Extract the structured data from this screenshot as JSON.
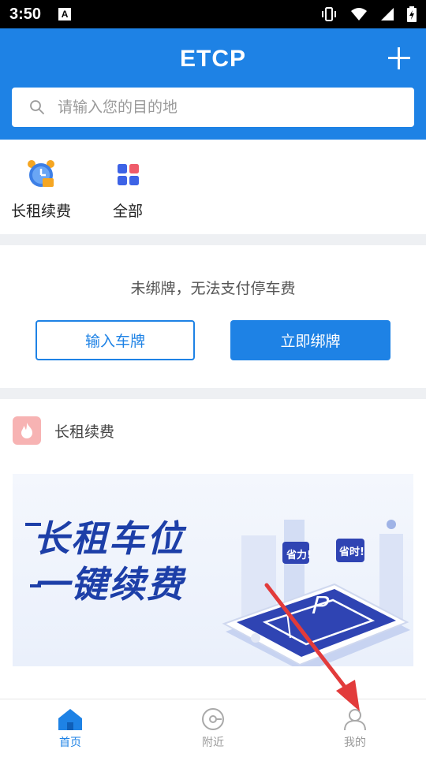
{
  "status_bar": {
    "time": "3:50",
    "notification_icon": "A"
  },
  "header": {
    "title": "ETCP",
    "add_icon": "plus-icon"
  },
  "search": {
    "placeholder": "请输入您的目的地"
  },
  "quick_entries": [
    {
      "label": "长租续费",
      "icon": "alarm-clock-icon"
    },
    {
      "label": "全部",
      "icon": "grid-apps-icon"
    }
  ],
  "plate_card": {
    "message": "未绑牌，无法支付停车费",
    "input_plate_label": "输入车牌",
    "bind_plate_label": "立即绑牌"
  },
  "rent_section": {
    "title": "长租续费",
    "banner": {
      "line1": "长租车位",
      "line2": "一键续费",
      "tag1": "省力!",
      "tag2": "省时!",
      "parking_letter": "P"
    }
  },
  "tabbar": {
    "tabs": [
      {
        "label": "首页",
        "active": true
      },
      {
        "label": "附近",
        "active": false
      },
      {
        "label": "我的",
        "active": false
      }
    ]
  },
  "colors": {
    "brand_blue": "#1e82e5",
    "banner_blue": "#1d3fa8",
    "flame_bg": "#f7b3b3",
    "annotation_red": "#e23b3b"
  }
}
